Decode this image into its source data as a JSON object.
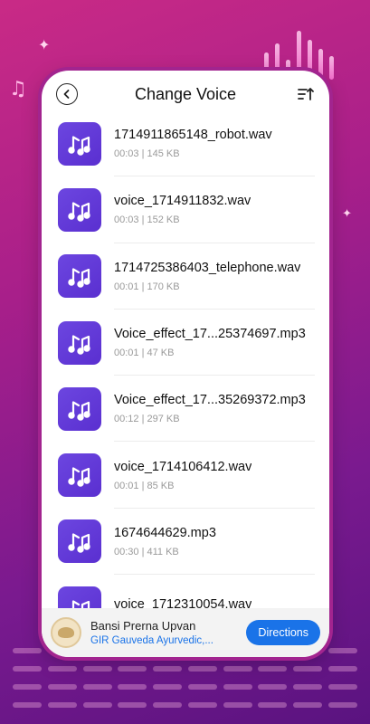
{
  "header": {
    "title": "Change Voice",
    "back_icon": "back-arrow-icon",
    "sort_icon": "sort-icon"
  },
  "files": [
    {
      "name": "1714911865148_robot.wav",
      "info": "00:03 | 145 KB"
    },
    {
      "name": "voice_1714911832.wav",
      "info": "00:03 | 152 KB"
    },
    {
      "name": "1714725386403_telephone.wav",
      "info": "00:01 | 170 KB"
    },
    {
      "name": "Voice_effect_17...25374697.mp3",
      "info": "00:01 | 47 KB"
    },
    {
      "name": "Voice_effect_17...35269372.mp3",
      "info": "00:12 | 297 KB"
    },
    {
      "name": "voice_1714106412.wav",
      "info": "00:01 | 85 KB"
    },
    {
      "name": "1674644629.mp3",
      "info": "00:30 | 411 KB"
    },
    {
      "name": "voice_1712310054.wav",
      "info": ""
    }
  ],
  "ad": {
    "title": "Bansi Prerna Upvan",
    "subtitle": "GIR Gauveda Ayurvedic,...",
    "button_label": "Directions"
  },
  "colors": {
    "accent": "#1a73e8",
    "thumb": "#5a2fd0",
    "background": "#a81f8a"
  }
}
